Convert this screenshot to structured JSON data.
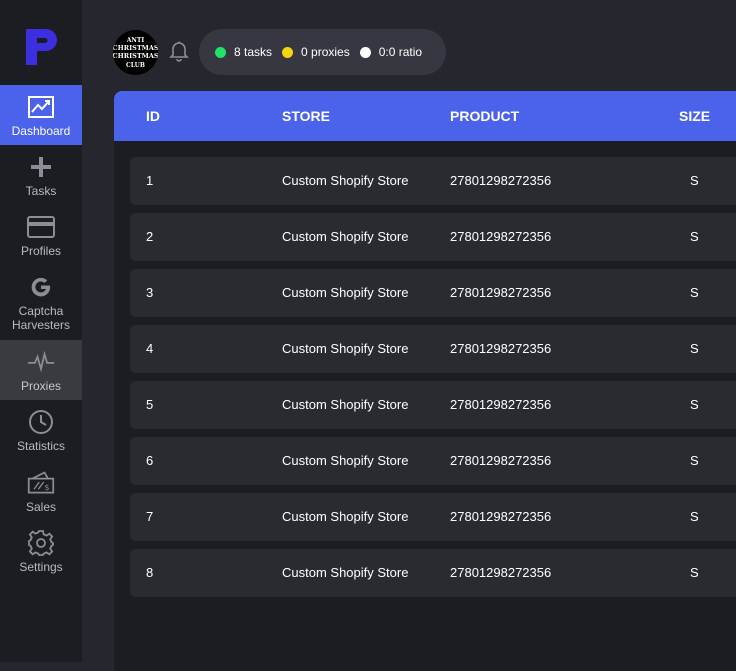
{
  "sidebar": {
    "items": [
      {
        "label": "Dashboard",
        "icon": "dashboard-chart-icon"
      },
      {
        "label": "Tasks",
        "icon": "plus-icon"
      },
      {
        "label": "Profiles",
        "icon": "card-icon"
      },
      {
        "label": "Captcha Harvesters",
        "icon": "google-g-icon"
      },
      {
        "label": "Proxies",
        "icon": "pulse-icon"
      },
      {
        "label": "Statistics",
        "icon": "clock-icon"
      },
      {
        "label": "Sales",
        "icon": "ticket-icon"
      },
      {
        "label": "Settings",
        "icon": "gear-icon"
      }
    ]
  },
  "header": {
    "avatar_text": [
      "ANTI",
      "CHRISTMAS",
      "CHRISTMAS",
      "CLUB"
    ],
    "stats": [
      {
        "text": "8 tasks",
        "color": "#22e26a"
      },
      {
        "text": "0 proxies",
        "color": "#f5d30f"
      },
      {
        "text": "0:0 ratio",
        "color": "#ffffff"
      }
    ]
  },
  "table": {
    "columns": [
      "ID",
      "STORE",
      "PRODUCT",
      "SIZE"
    ],
    "rows": [
      {
        "id": "1",
        "store": "Custom Shopify Store",
        "product": "27801298272356",
        "size": "S"
      },
      {
        "id": "2",
        "store": "Custom Shopify Store",
        "product": "27801298272356",
        "size": "S"
      },
      {
        "id": "3",
        "store": "Custom Shopify Store",
        "product": "27801298272356",
        "size": "S"
      },
      {
        "id": "4",
        "store": "Custom Shopify Store",
        "product": "27801298272356",
        "size": "S"
      },
      {
        "id": "5",
        "store": "Custom Shopify Store",
        "product": "27801298272356",
        "size": "S"
      },
      {
        "id": "6",
        "store": "Custom Shopify Store",
        "product": "27801298272356",
        "size": "S"
      },
      {
        "id": "7",
        "store": "Custom Shopify Store",
        "product": "27801298272356",
        "size": "S"
      },
      {
        "id": "8",
        "store": "Custom Shopify Store",
        "product": "27801298272356",
        "size": "S"
      }
    ]
  },
  "colors": {
    "accent": "#4b62ea",
    "logo": "#3b2fe0"
  }
}
